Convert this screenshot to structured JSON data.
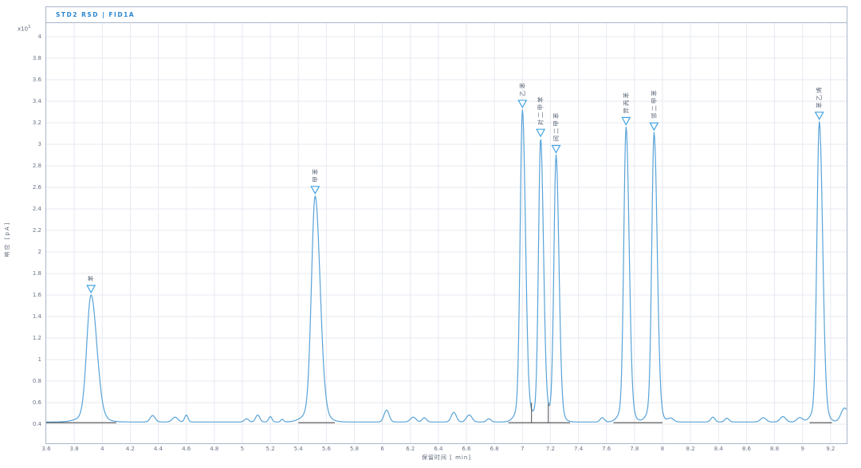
{
  "window": {
    "signal_header": "STD2 RSD | FID1A"
  },
  "chart_data": {
    "type": "line",
    "title": "STD2 RSD | FID1A",
    "xlabel": "保留时间 [  min]",
    "ylabel": "响应 [pA]",
    "y_scale": {
      "base": "x10",
      "exp": "1"
    },
    "xlim": [
      3.6,
      9.315
    ],
    "ylim": [
      0.222,
      4.126
    ],
    "x_ticks": [
      3.6,
      3.8,
      4,
      4.2,
      4.4,
      4.6,
      4.8,
      5,
      5.2,
      5.4,
      5.6,
      5.8,
      6,
      6.2,
      6.4,
      6.6,
      6.8,
      7,
      7.2,
      7.4,
      7.6,
      7.8,
      8,
      8.2,
      8.4,
      8.6,
      8.8,
      9,
      9.2
    ],
    "y_ticks": [
      0.4,
      0.6,
      0.8,
      1,
      1.2,
      1.4,
      1.6,
      1.8,
      2,
      2.2,
      2.4,
      2.6,
      2.8,
      3,
      3.2,
      3.4,
      3.6,
      3.8,
      4
    ],
    "grid": true,
    "legend": "none",
    "baseline": 0.42,
    "peaks": [
      {
        "label": "苯",
        "rt": 3.92,
        "apex": 1.6,
        "sigma": 0.03
      },
      {
        "label": "甲苯",
        "rt": 5.52,
        "apex": 2.52,
        "sigma": 0.026
      },
      {
        "label": "乙苯",
        "rt": 7.0,
        "apex": 3.32,
        "sigma": 0.016
      },
      {
        "label": "对二甲苯",
        "rt": 7.13,
        "apex": 3.05,
        "sigma": 0.015
      },
      {
        "label": "间二甲苯",
        "rt": 7.24,
        "apex": 2.9,
        "sigma": 0.015
      },
      {
        "label": "异丙苯",
        "rt": 7.74,
        "apex": 3.16,
        "sigma": 0.016
      },
      {
        "label": "邻二甲苯",
        "rt": 7.94,
        "apex": 3.11,
        "sigma": 0.016
      },
      {
        "label": "苯乙烯",
        "rt": 9.12,
        "apex": 3.21,
        "sigma": 0.017
      }
    ],
    "baseline_bumps": [
      [
        4.36,
        0.06,
        0.018
      ],
      [
        4.52,
        0.045,
        0.02
      ],
      [
        4.6,
        0.065,
        0.012
      ],
      [
        5.03,
        0.03,
        0.015
      ],
      [
        5.11,
        0.065,
        0.015
      ],
      [
        5.2,
        0.05,
        0.012
      ],
      [
        5.285,
        0.025,
        0.01
      ],
      [
        6.03,
        0.11,
        0.018
      ],
      [
        6.22,
        0.045,
        0.02
      ],
      [
        6.3,
        0.04,
        0.015
      ],
      [
        6.51,
        0.09,
        0.018
      ],
      [
        6.62,
        0.065,
        0.02
      ],
      [
        6.76,
        0.03,
        0.015
      ],
      [
        7.57,
        0.04,
        0.015
      ],
      [
        8.06,
        0.035,
        0.02
      ],
      [
        8.36,
        0.045,
        0.015
      ],
      [
        8.46,
        0.035,
        0.015
      ],
      [
        8.72,
        0.04,
        0.02
      ],
      [
        8.86,
        0.05,
        0.02
      ],
      [
        8.98,
        0.04,
        0.02
      ],
      [
        9.3,
        0.13,
        0.025
      ]
    ],
    "integration_segments": [
      [
        3.6,
        4.1
      ],
      [
        5.4,
        5.66
      ],
      [
        6.9,
        7.34
      ],
      [
        7.65,
        8.0
      ],
      [
        9.05,
        9.21
      ]
    ],
    "drop_lines": [
      7.065,
      7.185
    ],
    "colors": {
      "trace": "#58a3d8",
      "grid": "#e7eaf2",
      "frame": "#a9b6c9",
      "text": "#5b6577",
      "title": "#2d87cf",
      "marker": "#44a3e0",
      "integration": "#4a4a4a"
    }
  }
}
